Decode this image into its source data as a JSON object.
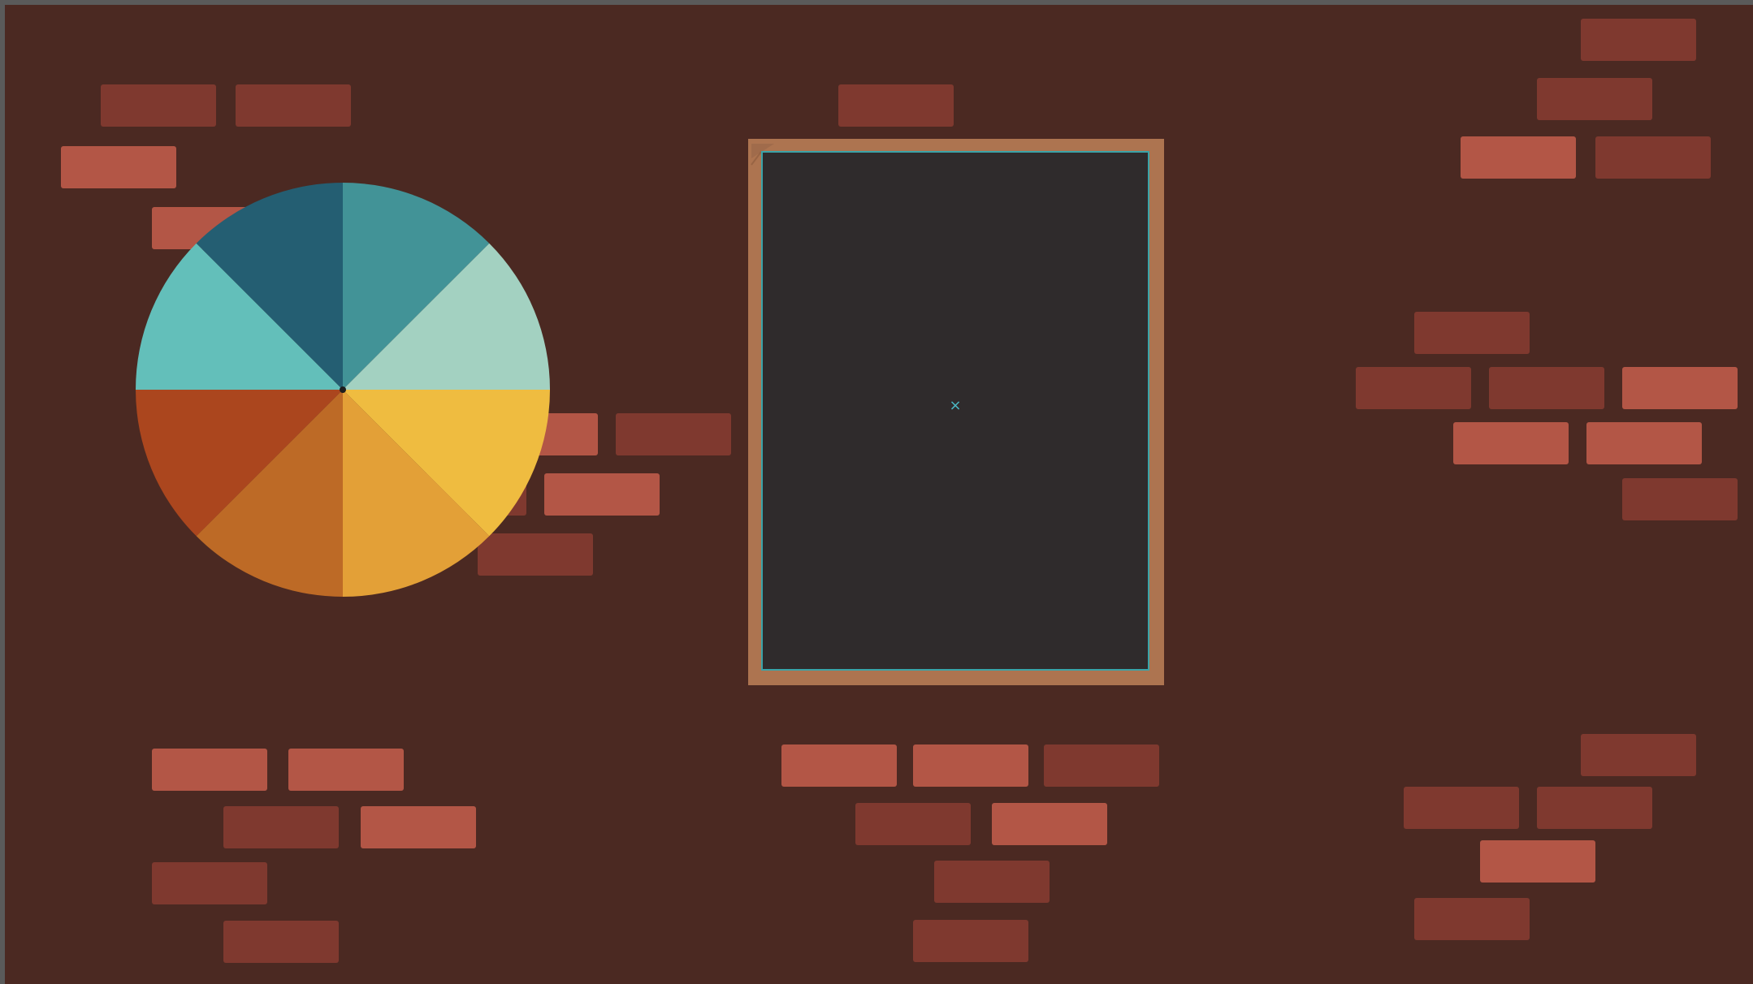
{
  "scene": {
    "background_color": "#4b2922",
    "brick_colors": {
      "dark": "#7f392f",
      "light": "#b35646"
    }
  },
  "spin_wheel": {
    "segment_count": 8,
    "segments": [
      {
        "name": "teal",
        "color": "#429397"
      },
      {
        "name": "mint",
        "color": "#a3d1c1"
      },
      {
        "name": "yellow",
        "color": "#efbc40"
      },
      {
        "name": "amber",
        "color": "#e3a037"
      },
      {
        "name": "orange",
        "color": "#bd6a26"
      },
      {
        "name": "rust",
        "color": "#ab461e"
      },
      {
        "name": "aqua",
        "color": "#63bfba"
      },
      {
        "name": "navy-teal",
        "color": "#245e72"
      }
    ],
    "hub_color": "#1e1e1e"
  },
  "board": {
    "frame_color": "#ad7450",
    "surface_color": "#2f2b2c",
    "border_color": "#3aa3a8",
    "center_marker": "×",
    "marker_icon": "close-icon"
  }
}
